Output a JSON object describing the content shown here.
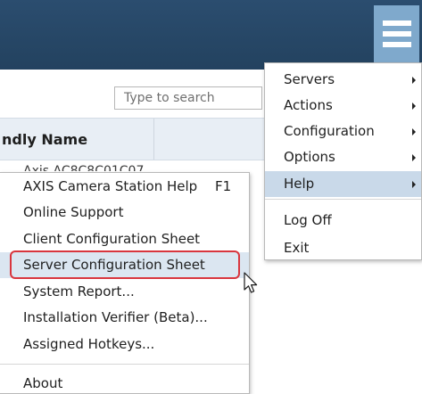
{
  "search": {
    "placeholder": "Type to search"
  },
  "table": {
    "column_header": "ndly Name",
    "partial_row_text": "Axis AC8C8C01C07"
  },
  "main_menu": {
    "items": [
      {
        "label": "Servers",
        "has_submenu": true
      },
      {
        "label": "Actions",
        "has_submenu": true
      },
      {
        "label": "Configuration",
        "has_submenu": true
      },
      {
        "label": "Options",
        "has_submenu": true
      },
      {
        "label": "Help",
        "has_submenu": true,
        "active": true
      },
      {
        "label": "Log Off",
        "has_submenu": false
      },
      {
        "label": "Exit",
        "has_submenu": false
      }
    ]
  },
  "help_menu": {
    "items": [
      {
        "label": "AXIS Camera Station Help",
        "shortcut": "F1"
      },
      {
        "label": "Online Support"
      },
      {
        "label": "Client Configuration Sheet"
      },
      {
        "label": "Server Configuration Sheet",
        "highlighted": true
      },
      {
        "label": "System Report..."
      },
      {
        "label": "Installation Verifier (Beta)..."
      },
      {
        "label": "Assigned Hotkeys..."
      },
      {
        "label": "About"
      }
    ]
  },
  "colors": {
    "header": "#2b4d6f",
    "hamburger": "#7fa9cc",
    "menu_active": "#c9d9e9",
    "menu_hover": "#dbe6f1",
    "callout_border": "#d9363e"
  },
  "icons": {
    "menu": "hamburger-icon",
    "submenu": "chevron-right-icon",
    "cursor": "mouse-pointer-icon"
  }
}
